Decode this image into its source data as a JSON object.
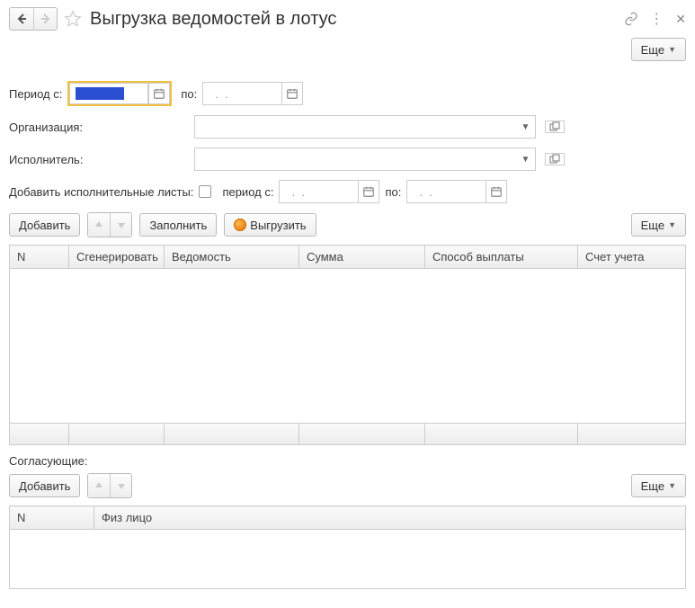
{
  "header": {
    "title": "Выгрузка ведомостей в лотус",
    "more_label": "Еще"
  },
  "period": {
    "from_label": "Период с:",
    "to_label": "по:",
    "from_value": "",
    "to_value": "  .  .",
    "placeholder_dots": "  .  ."
  },
  "organization": {
    "label": "Организация:",
    "value": ""
  },
  "executor": {
    "label": "Исполнитель:",
    "value": ""
  },
  "exec_docs": {
    "label": "Добавить исполнительные листы:",
    "checked": false,
    "from_label": "период с:",
    "to_label": "по:",
    "from_value": "  .  .",
    "to_value": "  .  ."
  },
  "toolbar1": {
    "add_label": "Добавить",
    "fill_label": "Заполнить",
    "export_label": "Выгрузить",
    "more_label": "Еще"
  },
  "table1": {
    "columns": [
      "N",
      "Сгенерировать",
      "Ведомость",
      "Сумма",
      "Способ выплаты",
      "Счет учета"
    ],
    "rows": []
  },
  "approvers": {
    "label": "Согласующие:"
  },
  "toolbar2": {
    "add_label": "Добавить",
    "more_label": "Еще"
  },
  "table2": {
    "columns": [
      "N",
      "Физ лицо"
    ],
    "rows": []
  }
}
